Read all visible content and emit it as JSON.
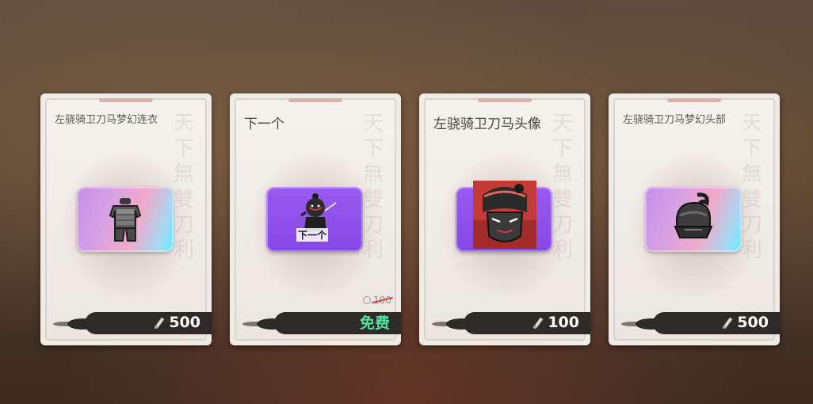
{
  "cards": [
    {
      "title": "左骁骑卫刀马梦幻连衣",
      "item_icon": "armor-suit-icon",
      "price": "500",
      "currency_icon": "scroll-icon"
    },
    {
      "title": "下一个",
      "item_icon": "ninja-warrior-icon",
      "item_caption": "下一个",
      "original_price": "100",
      "price_label": "免费",
      "currency_icon": "coin-icon"
    },
    {
      "title": "左骁骑卫刀马头像",
      "item_icon": "masked-warrior-portrait-icon",
      "price": "100",
      "currency_icon": "scroll-icon"
    },
    {
      "title": "左骁骑卫刀马梦幻头部",
      "item_icon": "helmet-icon",
      "price": "500",
      "currency_icon": "scroll-icon"
    }
  ],
  "colors": {
    "free_label": "#55e2a0",
    "strike": "#e04848",
    "tile_purple": "#8648e6",
    "price_bar": "#2d2a28"
  }
}
